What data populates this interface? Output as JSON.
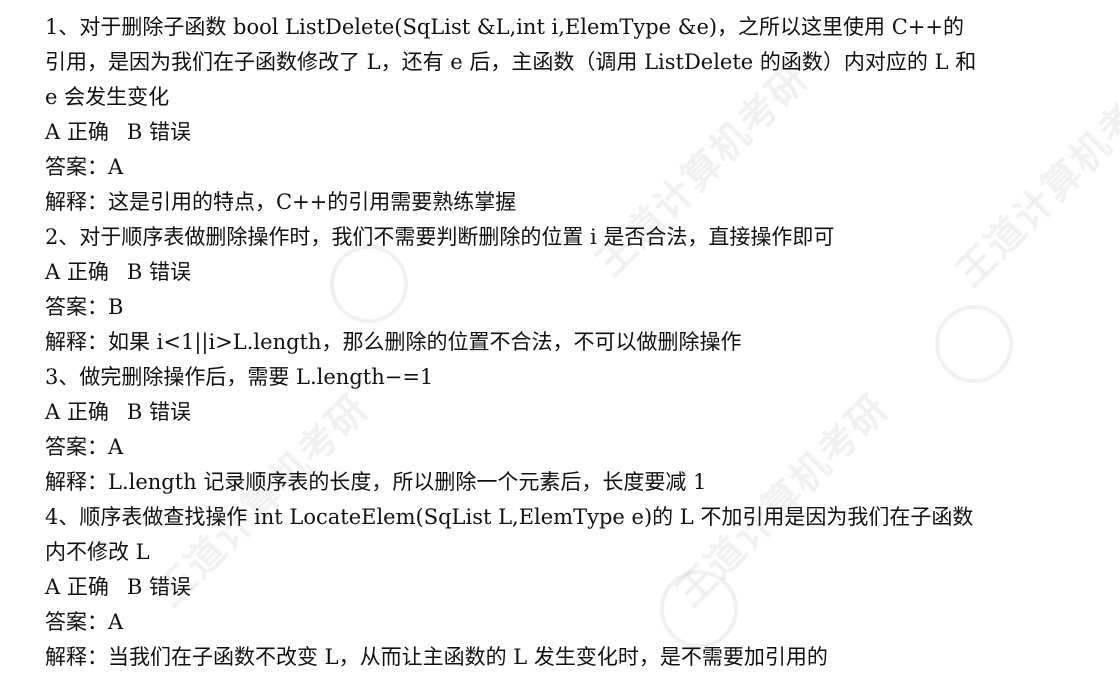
{
  "questions": [
    {
      "question": "1、对于删除子函数 bool ListDelete(SqList &L,int i,ElemType &e)，之所以这里使用 C++的引用，是因为我们在子函数修改了 L，还有 e 后，主函数（调用 ListDelete 的函数）内对应的 L 和 e 会发生变化",
      "option_a": "A 正确",
      "option_b": "B 错误",
      "answer": "答案：A",
      "explanation_prefix": "解释：",
      "explanation": "这是引用的特点，C++的引用需要熟练掌握"
    },
    {
      "question": "2、对于顺序表做删除操作时，我们不需要判断删除的位置 i 是否合法，直接操作即可",
      "option_a": "A 正确",
      "option_b": "B 错误",
      "answer": "答案：B",
      "explanation_prefix": "解释：",
      "explanation": "如果 i<1||i>L.length，那么删除的位置不合法，不可以做删除操作"
    },
    {
      "question": "3、做完删除操作后，需要 L.length−=1",
      "option_a": "A 正确",
      "option_b": "B 错误",
      "answer": "答案：A",
      "explanation_prefix": "解释：",
      "explanation": "L.length 记录顺序表的长度，所以删除一个元素后，长度要减 1"
    },
    {
      "question": "4、顺序表做查找操作 int LocateElem(SqList L,ElemType e)的 L 不加引用是因为我们在子函数内不修改 L",
      "option_a": "A 正确",
      "option_b": "B 错误",
      "answer": "答案：A",
      "explanation_prefix": "解释：",
      "explanation": "当我们在子函数不改变 L，从而让主函数的 L 发生变化时，是不需要加引用的"
    }
  ],
  "watermark": {
    "text": "王道计算机考研",
    "url": "www.cskaoyan.com"
  }
}
